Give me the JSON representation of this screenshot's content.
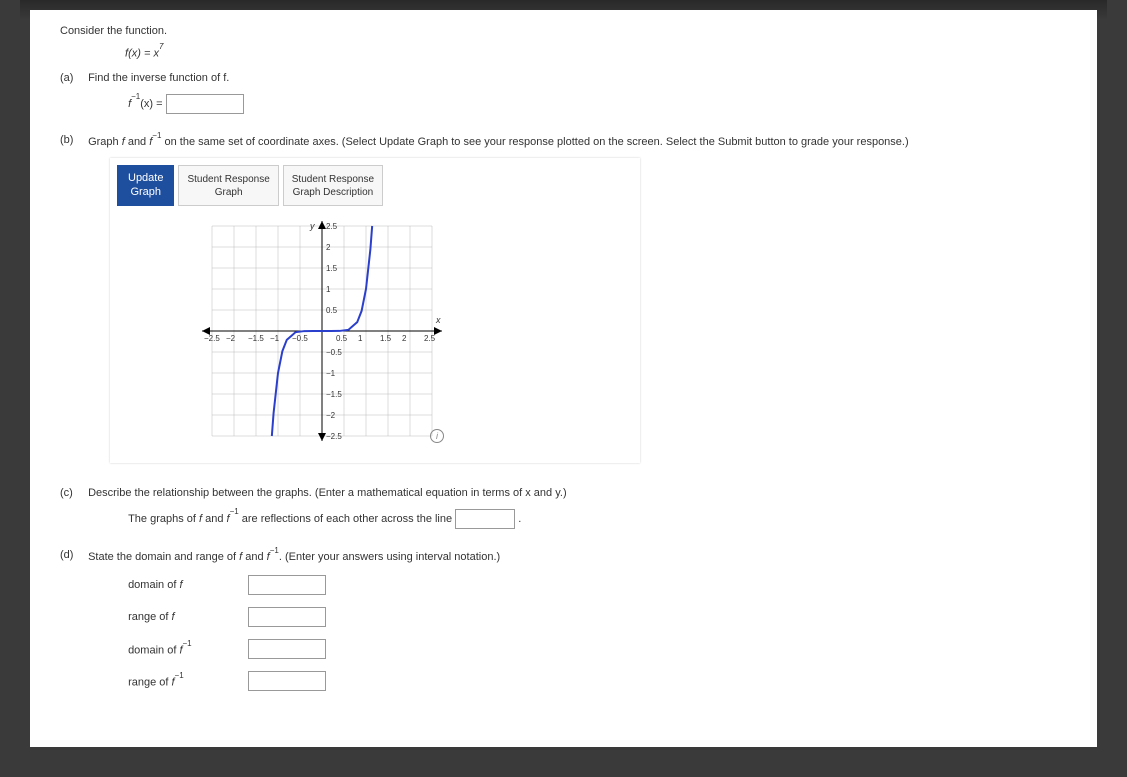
{
  "prompt_intro": "Consider the function.",
  "formula_func": "f",
  "formula_lhs_arg": "(x) = ",
  "formula_rhs_base": "x",
  "formula_rhs_exp": "7",
  "parts": {
    "a": {
      "label": "(a)",
      "prompt": "Find the inverse function of f.",
      "answer_prefix_f": "f",
      "answer_prefix_exp": "−1",
      "answer_prefix_tail": "(x) = "
    },
    "b": {
      "label": "(b)",
      "prompt_pre": "Graph ",
      "prompt_f": "f",
      "prompt_and": " and ",
      "prompt_finv_f": "f",
      "prompt_finv_exp": "−1",
      "prompt_tail": " on the same set of coordinate axes. (Select Update Graph to see your response plotted on the screen. Select the Submit button to grade your response.)",
      "update_btn_line1": "Update",
      "update_btn_line2": "Graph",
      "tab1_line1": "Student Response",
      "tab1_line2": "Graph",
      "tab2_line1": "Student Response",
      "tab2_line2": "Graph Description",
      "info_icon": "i",
      "axis_y": "y",
      "axis_x": "x"
    },
    "c": {
      "label": "(c)",
      "prompt": "Describe the relationship between the graphs. (Enter a mathematical equation in terms of x and y.)",
      "line_pre": "The graphs of ",
      "line_f": "f",
      "line_and": " and ",
      "line_finv_f": "f",
      "line_finv_exp": "−1",
      "line_tail": " are reflections of each other across the line ",
      "line_period": "."
    },
    "d": {
      "label": "(d)",
      "prompt_pre": "State the domain and range of ",
      "prompt_f": "f",
      "prompt_and": " and ",
      "prompt_finv_f": "f",
      "prompt_finv_exp": "−1",
      "prompt_tail": ". (Enter your answers using interval notation.)",
      "fields": {
        "domain_f": "domain of f",
        "range_f": "range of f",
        "domain_finv_pre": "domain of ",
        "domain_finv_f": "f",
        "domain_finv_exp": "−1",
        "range_finv_pre": "range of ",
        "range_finv_f": "f",
        "range_finv_exp": "−1"
      }
    }
  },
  "chart_data": {
    "type": "line",
    "title": "",
    "xlabel": "x",
    "ylabel": "y",
    "xlim": [
      -2.5,
      2.5
    ],
    "ylim": [
      -2.5,
      2.5
    ],
    "xticks": [
      -2.5,
      -2,
      -1.5,
      -1,
      -0.5,
      0.5,
      1,
      1.5,
      2,
      2.5
    ],
    "yticks": [
      -2.5,
      -2,
      -1.5,
      -1,
      -0.5,
      0.5,
      1,
      1.5,
      2,
      2.5
    ],
    "series": [
      {
        "name": "f(x)=x^7",
        "x": [
          -1.14,
          -1.1,
          -1.0,
          -0.9,
          -0.8,
          -0.6,
          -0.4,
          -0.2,
          0,
          0.2,
          0.4,
          0.6,
          0.8,
          0.9,
          1.0,
          1.1,
          1.14
        ],
        "y": [
          -2.5,
          -1.949,
          -1.0,
          -0.478,
          -0.21,
          -0.028,
          -0.0016,
          -1.28e-05,
          0,
          1.28e-05,
          0.0016,
          0.028,
          0.21,
          0.478,
          1.0,
          1.949,
          2.5
        ]
      }
    ]
  }
}
